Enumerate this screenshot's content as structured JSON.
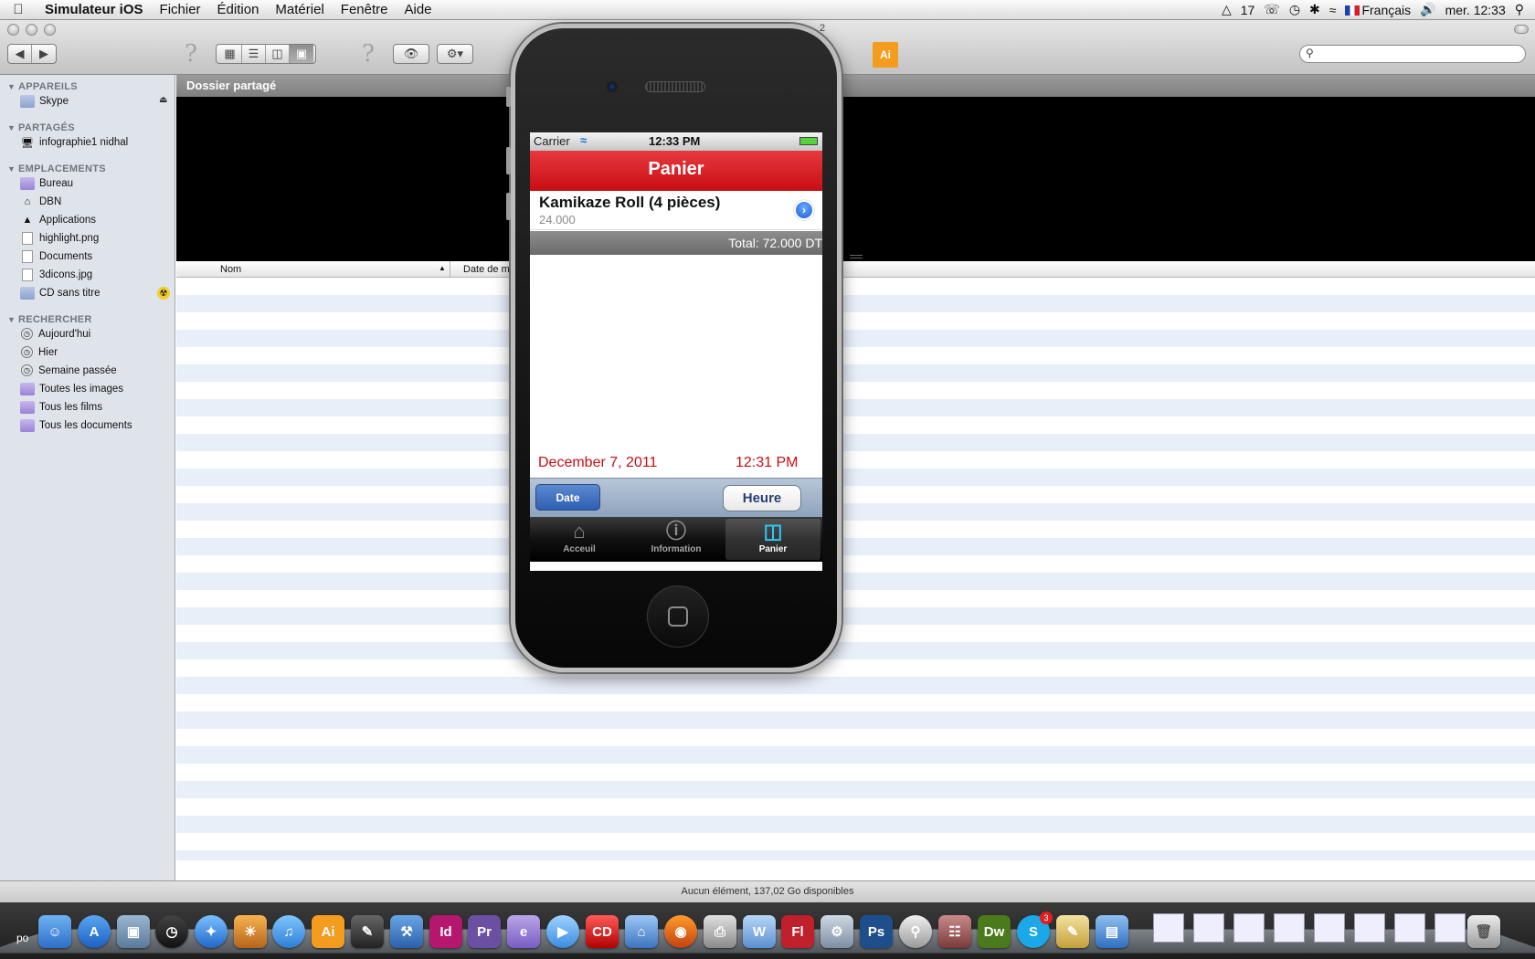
{
  "menubar": {
    "app_name": "Simulateur iOS",
    "menus": [
      "Fichier",
      "Édition",
      "Matériel",
      "Fenêtre",
      "Aide"
    ],
    "status": {
      "adobe_count": "17",
      "language": "Français",
      "clock": "mer. 12:33"
    }
  },
  "finder": {
    "sidebar": {
      "sections": [
        {
          "title": "APPAREILS",
          "items": [
            {
              "label": "Skype",
              "icon": "drive-icon"
            }
          ]
        },
        {
          "title": "PARTAGÉS",
          "items": [
            {
              "label": "infographie1 nidhal",
              "icon": "computer-icon"
            }
          ]
        },
        {
          "title": "EMPLACEMENTS",
          "items": [
            {
              "label": "Bureau",
              "icon": "desktop-icon"
            },
            {
              "label": "DBN",
              "icon": "home-icon"
            },
            {
              "label": "Applications",
              "icon": "applications-icon"
            },
            {
              "label": "highlight.png",
              "icon": "file-icon"
            },
            {
              "label": "Documents",
              "icon": "folder-icon"
            },
            {
              "label": "3dicons.jpg",
              "icon": "file-icon"
            },
            {
              "label": "CD sans titre",
              "icon": "cd-icon"
            }
          ]
        },
        {
          "title": "RECHERCHER",
          "items": [
            {
              "label": "Aujourd'hui",
              "icon": "clock-icon"
            },
            {
              "label": "Hier",
              "icon": "clock-icon"
            },
            {
              "label": "Semaine passée",
              "icon": "clock-icon"
            },
            {
              "label": "Toutes les images",
              "icon": "smart-folder-icon"
            },
            {
              "label": "Tous les films",
              "icon": "smart-folder-icon"
            },
            {
              "label": "Tous les documents",
              "icon": "smart-folder-icon"
            }
          ]
        }
      ]
    },
    "header_title": "Dossier partagé",
    "columns": {
      "name": "Nom",
      "date": "Date de m"
    },
    "window_number": "2",
    "status_text": "Aucun élément, 137,02 Go disponibles"
  },
  "iphone": {
    "status": {
      "carrier": "Carrier",
      "time": "12:33 PM"
    },
    "nav_title": "Panier",
    "cart_item": {
      "name": "Kamikaze Roll (4 pièces)",
      "price": "24.000"
    },
    "total": "Total: 72.000 DT",
    "selected_date": "December 7, 2011",
    "selected_time": "12:31 PM",
    "toolbar": {
      "date_button": "Date",
      "time_button": "Heure"
    },
    "tabs": [
      {
        "label": "Acceuil",
        "icon": "home-icon"
      },
      {
        "label": "Information",
        "icon": "info-icon"
      },
      {
        "label": "Panier",
        "icon": "basket-icon",
        "active": true
      }
    ]
  },
  "dock": {
    "label_fragment": "po",
    "apps": [
      "Finder",
      "App Store",
      "Aperçu",
      "Dashboard",
      "Safari",
      "iPhoto",
      "iTunes",
      "Illustrator",
      "Pages",
      "Xcode",
      "InDesign",
      "Premiere",
      "Encore",
      "QuickTime",
      "PrintCD",
      "Home",
      "Firefox",
      "Imprimante",
      "Wood",
      "Flash",
      "Préférences",
      "Photoshop",
      "Dreamweaver",
      "Skype",
      "Utilitaire",
      "Instruments"
    ],
    "skype_badge": "3"
  }
}
